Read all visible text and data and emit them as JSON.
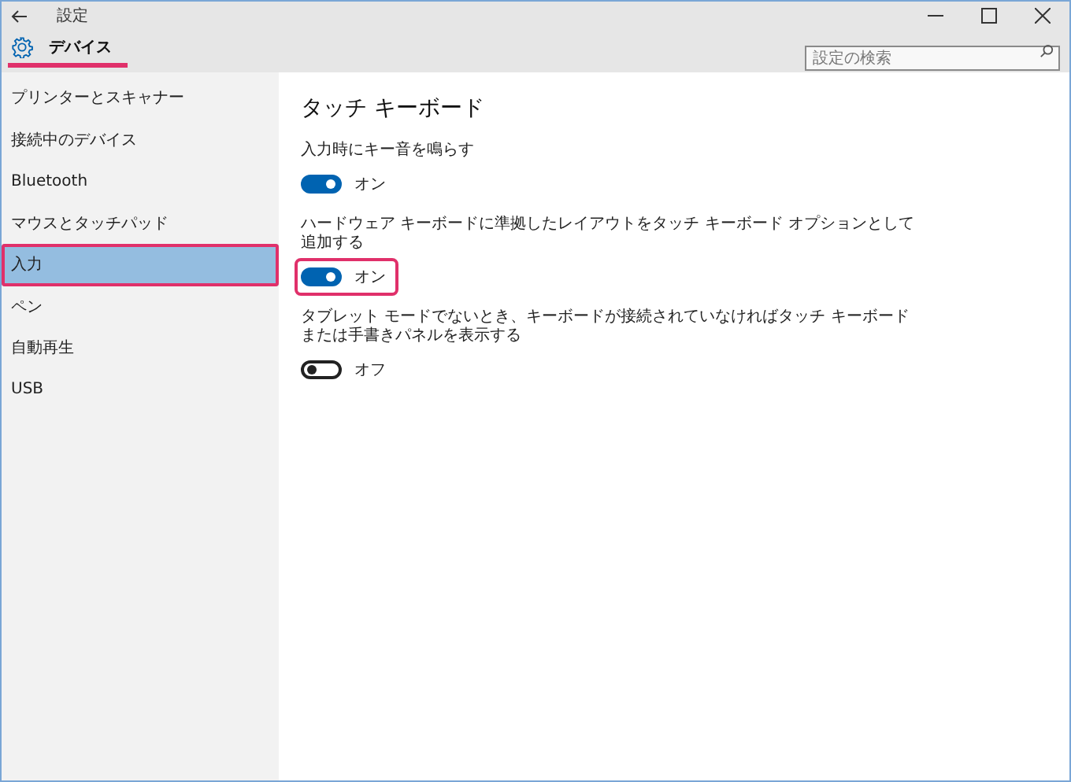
{
  "window": {
    "title": "設定"
  },
  "header": {
    "title": "デバイス",
    "underlined": true
  },
  "search": {
    "placeholder": "設定の検索"
  },
  "sidebar": {
    "items": [
      {
        "label": "プリンターとスキャナー",
        "selected": false,
        "highlighted": false
      },
      {
        "label": "接続中のデバイス",
        "selected": false,
        "highlighted": false
      },
      {
        "label": "Bluetooth",
        "selected": false,
        "highlighted": false
      },
      {
        "label": "マウスとタッチパッド",
        "selected": false,
        "highlighted": false
      },
      {
        "label": "入力",
        "selected": true,
        "highlighted": true
      },
      {
        "label": "ペン",
        "selected": false,
        "highlighted": false
      },
      {
        "label": "自動再生",
        "selected": false,
        "highlighted": false
      },
      {
        "label": "USB",
        "selected": false,
        "highlighted": false
      }
    ]
  },
  "content": {
    "title": "タッチ キーボード",
    "settings": [
      {
        "label": "入力時にキー音を鳴らす",
        "on": true,
        "state_text": "オン",
        "highlighted": false
      },
      {
        "label": "ハードウェア キーボードに準拠したレイアウトをタッチ キーボード オプションとして追加する",
        "on": true,
        "state_text": "オン",
        "highlighted": true
      },
      {
        "label": "タブレット モードでないとき、キーボードが接続されていなければタッチ キーボードまたは手書きパネルを表示する",
        "on": false,
        "state_text": "オフ",
        "highlighted": false
      }
    ]
  }
}
